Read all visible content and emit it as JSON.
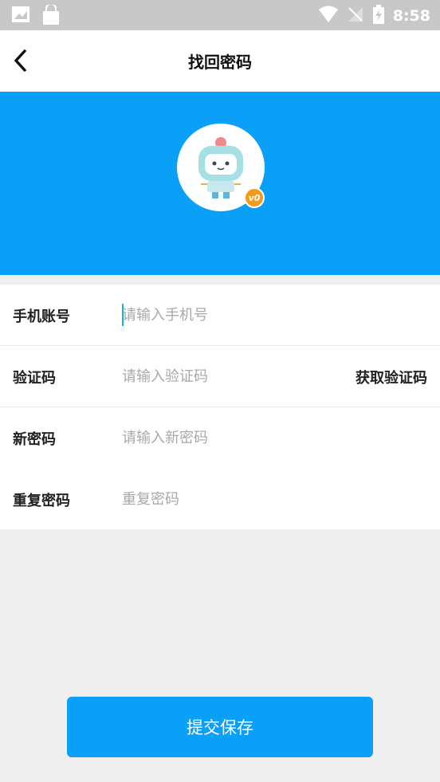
{
  "status_bar": {
    "time": "8:58"
  },
  "header": {
    "title": "找回密码"
  },
  "profile": {
    "badge_text": "v0"
  },
  "form": {
    "rows": [
      {
        "label": "手机账号",
        "placeholder": "请输入手机号"
      },
      {
        "label": "验证码",
        "placeholder": "请输入验证码",
        "action": "获取验证码"
      },
      {
        "label": "新密码",
        "placeholder": "请输入新密码"
      },
      {
        "label": "重复密码",
        "placeholder": "重复密码"
      }
    ]
  },
  "submit_label": "提交保存",
  "colors": {
    "accent": "#0aa0f7",
    "status_bar": "#c8c8c8",
    "background": "#efefef",
    "badge": "#f59b1c"
  }
}
